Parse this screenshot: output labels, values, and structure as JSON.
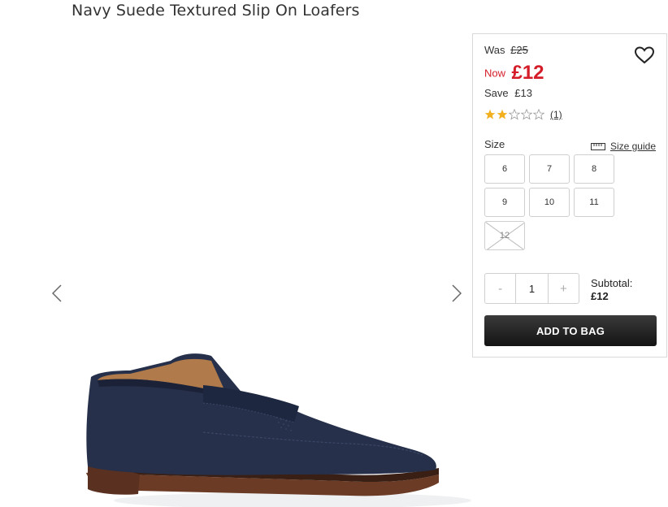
{
  "product": {
    "title": "Navy Suede Textured Slip On Loafers",
    "image_alt": "navy suede loafer"
  },
  "pricing": {
    "was_label": "Was",
    "was_price": "£25",
    "now_label": "Now",
    "now_price": "£12",
    "save_label": "Save",
    "save_amount": "£13",
    "price_color": "#d51c29"
  },
  "rating": {
    "value": 2,
    "max": 5,
    "review_count": "(1)",
    "star_color": "#f2b01e"
  },
  "sizes": {
    "label": "Size",
    "guide_label": "Size guide",
    "options": [
      {
        "label": "6",
        "available": true
      },
      {
        "label": "7",
        "available": true
      },
      {
        "label": "8",
        "available": true
      },
      {
        "label": "9",
        "available": true
      },
      {
        "label": "10",
        "available": true
      },
      {
        "label": "11",
        "available": true
      },
      {
        "label": "12",
        "available": false
      }
    ]
  },
  "quantity": {
    "minus": "-",
    "value": "1",
    "plus": "+"
  },
  "subtotal": {
    "label": "Subtotal:",
    "value": "£12"
  },
  "actions": {
    "add_to_bag": "ADD TO BAG"
  },
  "icons": {
    "wishlist": "heart-icon",
    "gallery_prev": "chevron-left-icon",
    "gallery_next": "chevron-right-icon",
    "size_guide": "ruler-icon"
  }
}
